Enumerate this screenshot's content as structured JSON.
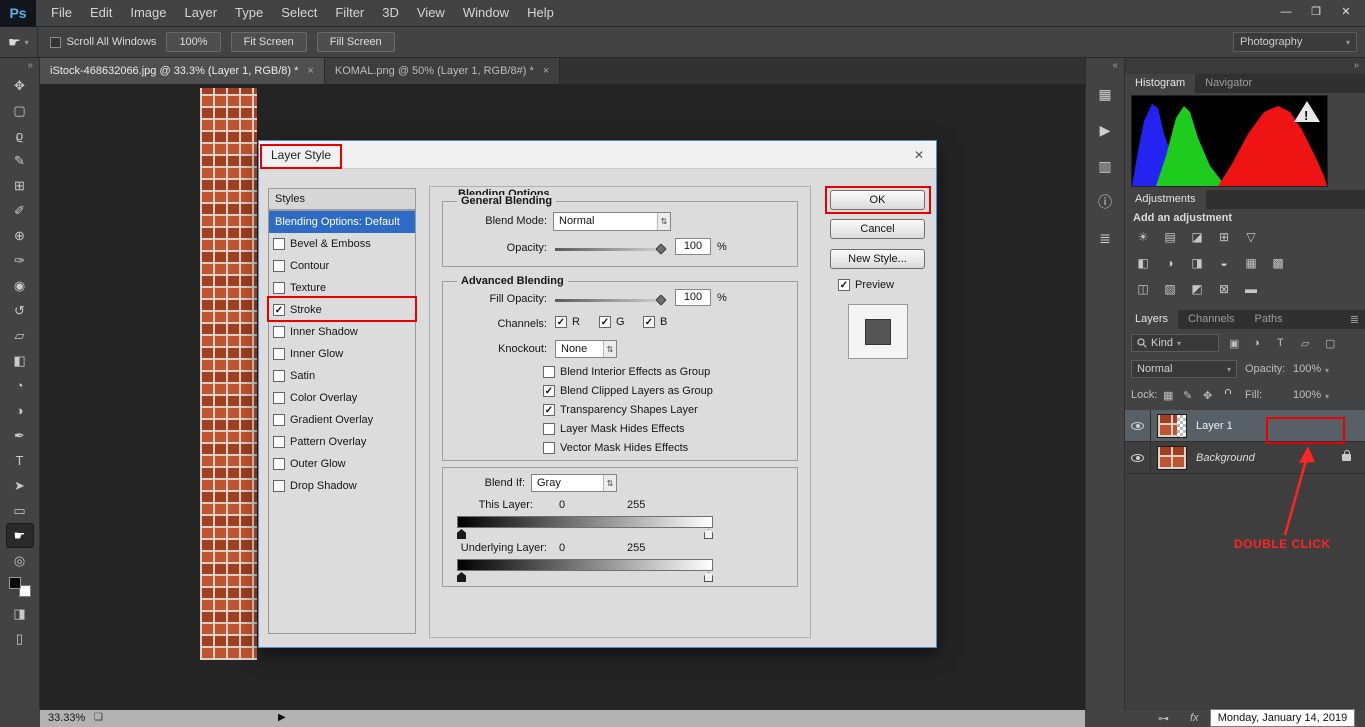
{
  "menubar": {
    "logo": "Ps",
    "items": [
      "File",
      "Edit",
      "Image",
      "Layer",
      "Type",
      "Select",
      "Filter",
      "3D",
      "View",
      "Window",
      "Help"
    ],
    "window_controls": {
      "minimize": "—",
      "restore": "❐",
      "close": "✕"
    }
  },
  "options_bar": {
    "tool_caret": "▾",
    "scroll_all_windows": "Scroll All Windows",
    "zoom_button": "100%",
    "fit_screen": "Fit Screen",
    "fill_screen": "Fill Screen",
    "workspace": "Photography",
    "workspace_caret": "▾"
  },
  "document_tabs": [
    {
      "label": "iStock-468632066.jpg @ 33.3% (Layer 1, RGB/8) *",
      "close": "×"
    },
    {
      "label": "KOMAL.png @ 50% (Layer 1, RGB/8#) *",
      "close": "×"
    }
  ],
  "toolbar": {
    "expand": "»",
    "tools": [
      {
        "name": "move",
        "glyph": "✥"
      },
      {
        "name": "marquee",
        "glyph": "▢"
      },
      {
        "name": "lasso",
        "glyph": "ϱ"
      },
      {
        "name": "quick-selection",
        "glyph": "✎"
      },
      {
        "name": "crop",
        "glyph": "⊞"
      },
      {
        "name": "eyedropper",
        "glyph": "✐"
      },
      {
        "name": "healing-brush",
        "glyph": "⊕"
      },
      {
        "name": "brush",
        "glyph": "✑"
      },
      {
        "name": "clone-stamp",
        "glyph": "◉"
      },
      {
        "name": "history-brush",
        "glyph": "↺"
      },
      {
        "name": "eraser",
        "glyph": "▱"
      },
      {
        "name": "gradient",
        "glyph": "◧"
      },
      {
        "name": "blur",
        "glyph": "◔"
      },
      {
        "name": "dodge",
        "glyph": "◑"
      },
      {
        "name": "pen",
        "glyph": "✒"
      },
      {
        "name": "type",
        "glyph": "T"
      },
      {
        "name": "path-selection",
        "glyph": "➤"
      },
      {
        "name": "rectangle",
        "glyph": "▭"
      },
      {
        "name": "hand",
        "glyph": "☛"
      },
      {
        "name": "zoom",
        "glyph": "◎"
      },
      {
        "name": "quick-mask",
        "glyph": "◨"
      },
      {
        "name": "screen-mode",
        "glyph": "▯"
      }
    ]
  },
  "dialog": {
    "title": "Layer Style",
    "close": "✕",
    "styles_header": "Styles",
    "styles_list": [
      {
        "label": "Blending Options: Default"
      },
      {
        "label": "Bevel & Emboss",
        "mark": ""
      },
      {
        "label": "Contour",
        "mark": ""
      },
      {
        "label": "Texture",
        "mark": ""
      },
      {
        "label": "Stroke",
        "mark": "✓"
      },
      {
        "label": "Inner Shadow",
        "mark": ""
      },
      {
        "label": "Inner Glow",
        "mark": ""
      },
      {
        "label": "Satin",
        "mark": ""
      },
      {
        "label": "Color Overlay",
        "mark": ""
      },
      {
        "label": "Gradient Overlay",
        "mark": ""
      },
      {
        "label": "Pattern Overlay",
        "mark": ""
      },
      {
        "label": "Outer Glow",
        "mark": ""
      },
      {
        "label": "Drop Shadow",
        "mark": ""
      }
    ],
    "section_title": "Blending Options",
    "general": {
      "legend": "General Blending",
      "blend_mode_label": "Blend Mode:",
      "blend_mode_value": "Normal",
      "opacity_label": "Opacity:",
      "opacity_value": "100",
      "percent": "%"
    },
    "advanced": {
      "legend": "Advanced Blending",
      "fill_opacity_label": "Fill Opacity:",
      "fill_opacity_value": "100",
      "percent": "%",
      "channels_label": "Channels:",
      "channels": [
        {
          "label": "R",
          "mark": "✓"
        },
        {
          "label": "G",
          "mark": "✓"
        },
        {
          "label": "B",
          "mark": "✓"
        }
      ],
      "knockout_label": "Knockout:",
      "knockout_value": "None",
      "options": [
        {
          "label": "Blend Interior Effects as Group",
          "mark": ""
        },
        {
          "label": "Blend Clipped Layers as Group",
          "mark": "✓"
        },
        {
          "label": "Transparency Shapes Layer",
          "mark": "✓"
        },
        {
          "label": "Layer Mask Hides Effects",
          "mark": ""
        },
        {
          "label": "Vector Mask Hides Effects",
          "mark": ""
        }
      ]
    },
    "blend_if": {
      "label": "Blend If:",
      "value": "Gray",
      "this_layer_label": "This Layer:",
      "this_min": "0",
      "this_max": "255",
      "underlying_label": "Underlying Layer:",
      "under_min": "0",
      "under_max": "255"
    },
    "buttons": {
      "ok": "OK",
      "cancel": "Cancel",
      "new_style": "New Style...",
      "preview_mark": "✓",
      "preview": "Preview"
    }
  },
  "panels": {
    "strip": {
      "collapse": "«",
      "icons": [
        {
          "name": "swatches-panel",
          "glyph": "▦"
        },
        {
          "name": "actions-panel",
          "glyph": "▶"
        },
        {
          "name": "styles-panel",
          "glyph": "▥"
        },
        {
          "name": "info-panel",
          "glyph": "ⓘ"
        },
        {
          "name": "history-panel",
          "glyph": "≣"
        }
      ]
    },
    "collapse_right": "»",
    "histogram": {
      "tabs": [
        "Histogram",
        "Navigator"
      ]
    },
    "adjustments": {
      "tab": "Adjustments",
      "title": "Add an adjustment",
      "rows": [
        [
          {
            "name": "brightness-contrast",
            "glyph": "☀"
          },
          {
            "name": "levels",
            "glyph": "▤"
          },
          {
            "name": "curves",
            "glyph": "◪"
          },
          {
            "name": "exposure",
            "glyph": "⊞"
          },
          {
            "name": "vibrance",
            "glyph": "▽"
          }
        ],
        [
          {
            "name": "hue-saturation",
            "glyph": "◧"
          },
          {
            "name": "color-balance",
            "glyph": "◑"
          },
          {
            "name": "black-white",
            "glyph": "◨"
          },
          {
            "name": "photo-filter",
            "glyph": "◒"
          },
          {
            "name": "channel-mixer",
            "glyph": "▦"
          },
          {
            "name": "color-lookup",
            "glyph": "▩"
          }
        ],
        [
          {
            "name": "invert",
            "glyph": "◫"
          },
          {
            "name": "posterize",
            "glyph": "▧"
          },
          {
            "name": "threshold",
            "glyph": "◩"
          },
          {
            "name": "selective-color",
            "glyph": "⊠"
          },
          {
            "name": "gradient-map",
            "glyph": "▬"
          }
        ]
      ]
    },
    "layers": {
      "tabs": [
        "Layers",
        "Channels",
        "Paths"
      ],
      "menu": "≣",
      "kind": "Kind",
      "kind_caret": "▾",
      "filter_icons": [
        {
          "name": "filter-pixel-layers",
          "glyph": "▣"
        },
        {
          "name": "filter-adjustment-layers",
          "glyph": "◑"
        },
        {
          "name": "filter-type-layers",
          "glyph": "T"
        },
        {
          "name": "filter-shape-layers",
          "glyph": "▱"
        },
        {
          "name": "filter-smart-objects",
          "glyph": "▢"
        }
      ],
      "blend_mode": "Normal",
      "caret": "▾",
      "opacity_label": "Opacity:",
      "opacity_value": "100%",
      "lock_label": "Lock:",
      "lock_icons": [
        {
          "name": "lock-transparent-pixels",
          "glyph": "▦"
        },
        {
          "name": "lock-image-pixels",
          "glyph": "✎"
        },
        {
          "name": "lock-position",
          "glyph": "✥"
        }
      ],
      "fill_label": "Fill:",
      "fill_value": "100%",
      "rows": [
        {
          "name": "Layer 1"
        },
        {
          "name": "Background"
        }
      ],
      "bottom": {
        "link": "⊶",
        "fx": "fx"
      }
    }
  },
  "annotations": {
    "double_click": "DOUBLE CLICK"
  },
  "statusbar": {
    "zoom": "33.33%",
    "doc_icon": "❏",
    "overflow": "▶",
    "date": "Monday, January 14, 2019"
  }
}
